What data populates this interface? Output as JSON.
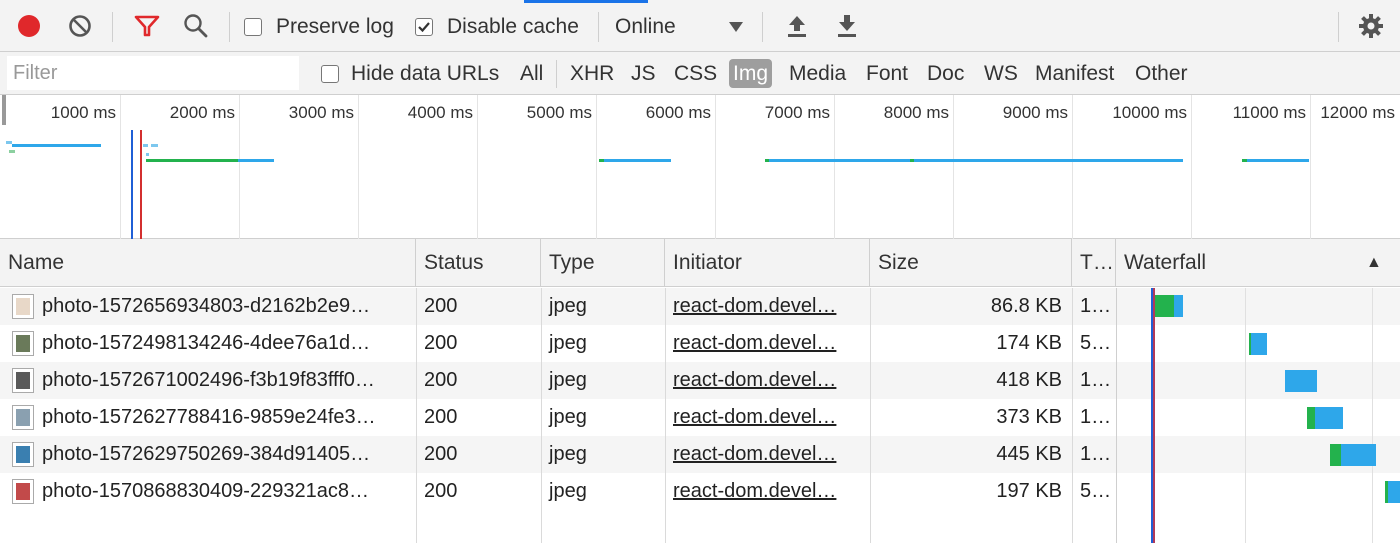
{
  "toolbar": {
    "preserve_log_label": "Preserve log",
    "preserve_log_checked": false,
    "disable_cache_label": "Disable cache",
    "disable_cache_checked": true,
    "throttle_value": "Online",
    "icons": [
      "record-icon",
      "clear-icon",
      "filter-icon",
      "search-icon",
      "upload-icon",
      "download-icon",
      "settings-icon"
    ],
    "colors": {
      "record": "#e0282b",
      "filter": "#e0282b",
      "active_tab": "#1a73e8"
    }
  },
  "filterbar": {
    "filter_placeholder": "Filter",
    "hide_data_urls_label": "Hide data URLs",
    "types": [
      "All",
      "XHR",
      "JS",
      "CSS",
      "Img",
      "Media",
      "Font",
      "Doc",
      "WS",
      "Manifest",
      "Other"
    ],
    "selected_type": "Img"
  },
  "overview": {
    "ticks": [
      "1000 ms",
      "2000 ms",
      "3000 ms",
      "4000 ms",
      "5000 ms",
      "6000 ms",
      "7000 ms",
      "8000 ms",
      "9000 ms",
      "10000 ms",
      "11000 ms",
      "12000 ms"
    ],
    "colors": {
      "waiting": "#23b24d",
      "download": "#2ea7ea",
      "dom_content_loaded": "#1f5fd6",
      "load": "#d32f2f"
    }
  },
  "table": {
    "columns": [
      "Name",
      "Status",
      "Type",
      "Initiator",
      "Size",
      "T…",
      "Waterfall"
    ],
    "sort_indicator": "▲",
    "rows": [
      {
        "name": "photo-1572656934803-d2162b2e9…",
        "status": "200",
        "type": "jpeg",
        "initiator": "react-dom.devel…",
        "size": "86.8 KB",
        "time": "1…",
        "thumb_color": "#e8d8c8"
      },
      {
        "name": "photo-1572498134246-4dee76a1d…",
        "status": "200",
        "type": "jpeg",
        "initiator": "react-dom.devel…",
        "size": "174 KB",
        "time": "5…",
        "thumb_color": "#6a7a5a"
      },
      {
        "name": "photo-1572671002496-f3b19f83fff0…",
        "status": "200",
        "type": "jpeg",
        "initiator": "react-dom.devel…",
        "size": "418 KB",
        "time": "1…",
        "thumb_color": "#5a5a5a"
      },
      {
        "name": "photo-1572627788416-9859e24fe3…",
        "status": "200",
        "type": "jpeg",
        "initiator": "react-dom.devel…",
        "size": "373 KB",
        "time": "1…",
        "thumb_color": "#8aa0b0"
      },
      {
        "name": "photo-1572629750269-384d91405…",
        "status": "200",
        "type": "jpeg",
        "initiator": "react-dom.devel…",
        "size": "445 KB",
        "time": "1…",
        "thumb_color": "#3a7fb0"
      },
      {
        "name": "photo-1570868830409-229321ac8…",
        "status": "200",
        "type": "jpeg",
        "initiator": "react-dom.devel…",
        "size": "197 KB",
        "time": "5…",
        "thumb_color": "#c24a4a"
      }
    ]
  }
}
